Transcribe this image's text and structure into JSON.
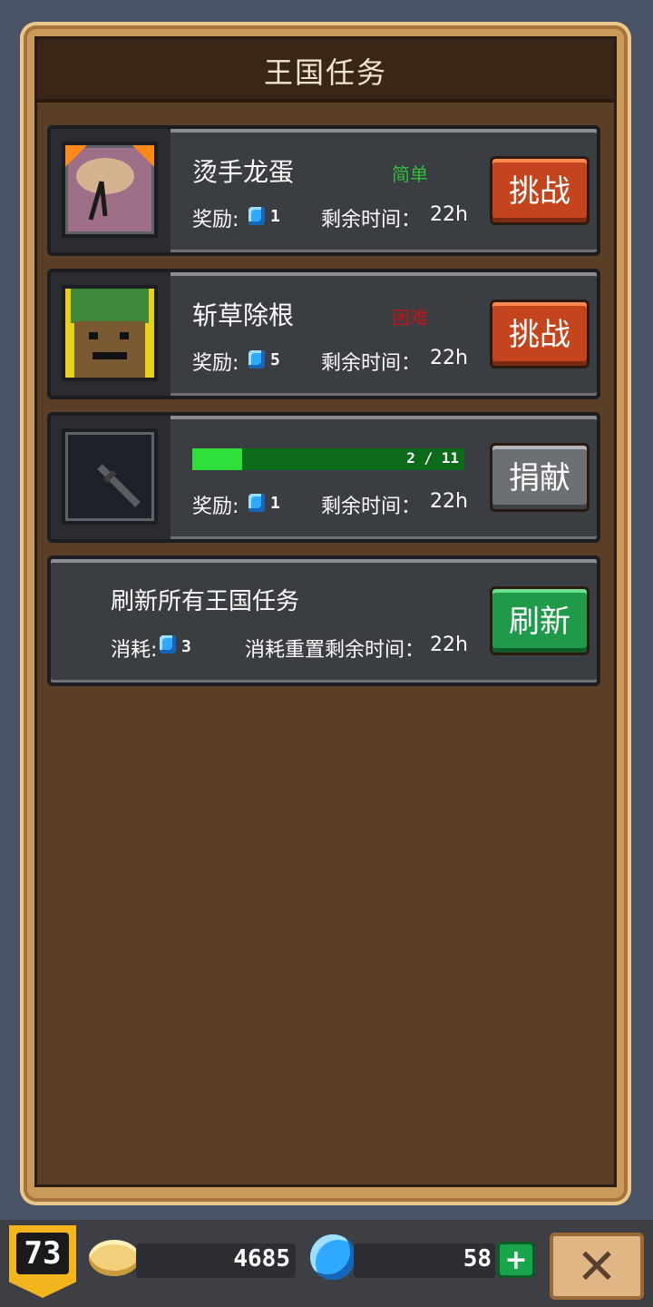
{
  "title": "王国任务",
  "quests": [
    {
      "name": "烫手龙蛋",
      "difficulty": "简单",
      "difficulty_color": "#2fbf3a",
      "reward_label": "奖励:",
      "reward_value": "1",
      "time_label": "剩余时间：",
      "time_value": "22h",
      "button_label": "挑战",
      "thumb_icon": "dragon-egg-icon"
    },
    {
      "name": "斩草除根",
      "difficulty": "困难",
      "difficulty_color": "#c0161a",
      "reward_label": "奖励:",
      "reward_value": "5",
      "time_label": "剩余时间：",
      "time_value": "22h",
      "button_label": "挑战",
      "thumb_icon": "treant-icon"
    }
  ],
  "donation": {
    "progress_text": "2 / 11",
    "progress_current": 2,
    "progress_total": 11,
    "reward_label": "奖励:",
    "reward_value": "1",
    "time_label": "剩余时间：",
    "time_value": "22h",
    "button_label": "捐献",
    "thumb_icon": "sword-icon"
  },
  "refresh": {
    "title": "刷新所有王国任务",
    "cost_label": "消耗:",
    "cost_value": "3",
    "reset_label": "消耗重置剩余时间：",
    "reset_value": "22h",
    "button_label": "刷新"
  },
  "bottom": {
    "level": "73",
    "coins": "4685",
    "gems": "58",
    "plus_label": "+",
    "close_label": "✕"
  }
}
